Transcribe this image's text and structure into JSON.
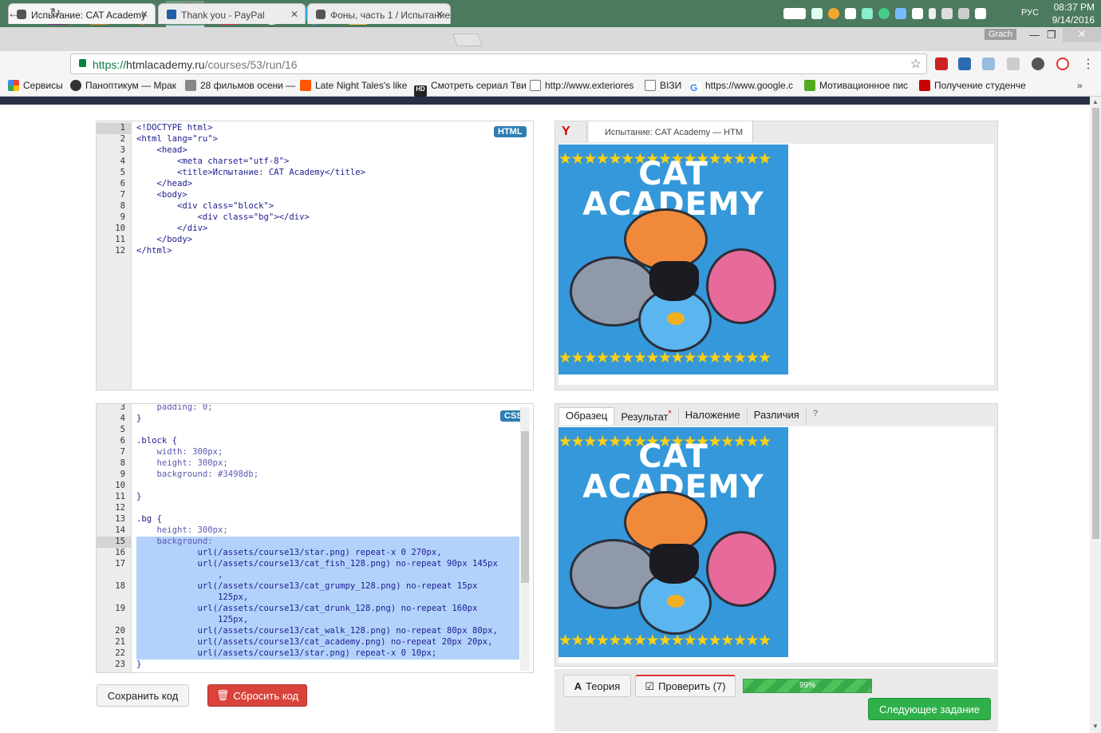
{
  "taskbar": {
    "apps": [
      {
        "name": "windows-start",
        "color": "#ffffff"
      },
      {
        "name": "onenote",
        "color": "#8b2a8c"
      },
      {
        "name": "app-orange",
        "color": "#d98c2b"
      },
      {
        "name": "firefox",
        "color": "#e6692a"
      },
      {
        "name": "chrome",
        "color": "#34a853"
      },
      {
        "name": "pocket",
        "color": "#e0344b"
      },
      {
        "name": "itunes",
        "color": "#d85ac4"
      },
      {
        "name": "telegram",
        "color": "#2ea6dd"
      },
      {
        "name": "file-explorer",
        "color": "#f3c544"
      }
    ],
    "language": "РУС",
    "time": "08:37 PM",
    "date": "9/14/2016"
  },
  "browser": {
    "tabs": [
      {
        "title": "Испытание: CAT Academy",
        "active": true
      },
      {
        "title": "Thank you - PayPal",
        "active": false
      },
      {
        "title": "Фоны, часть 1 / Испытание",
        "active": false
      }
    ],
    "profile": "Grach",
    "url_scheme": "https://",
    "url_host": "htmlacademy.ru",
    "url_path": "/courses/53/run/16",
    "bookmarks": [
      "Сервисы",
      "Паноптикум — Мрак",
      "28 фильмов осени —",
      "Late Night Tales's like",
      "Смотреть сериал Тви",
      "http://www.exteriores",
      "ВІЗИ",
      "https://www.google.c",
      "Мотивационное пис",
      "Получение студенче"
    ],
    "bookmarks_more": "»"
  },
  "html_editor": {
    "badge": "HTML",
    "lines": [
      "<!DOCTYPE html>",
      "<html lang=\"ru\">",
      "    <head>",
      "        <meta charset=\"utf-8\">",
      "        <title>Испытание: CAT Academy</title>",
      "    </head>",
      "    <body>",
      "        <div class=\"block\">",
      "            <div class=\"bg\"></div>",
      "        </div>",
      "    </body>",
      "</html>"
    ]
  },
  "css_editor": {
    "badge": "CSS",
    "lines": [
      {
        "n": "3",
        "text": "    padding: 0;"
      },
      {
        "n": "4",
        "text": "}"
      },
      {
        "n": "5",
        "text": ""
      },
      {
        "n": "6",
        "text": ".block {"
      },
      {
        "n": "7",
        "text": "    width: 300px;"
      },
      {
        "n": "8",
        "text": "    height: 300px;"
      },
      {
        "n": "9",
        "text": "    background: #3498db;"
      },
      {
        "n": "10",
        "text": ""
      },
      {
        "n": "11",
        "text": "}"
      },
      {
        "n": "12",
        "text": ""
      },
      {
        "n": "13",
        "text": ".bg {"
      },
      {
        "n": "14",
        "text": "    height: 300px;"
      },
      {
        "n": "15",
        "text": "    background:"
      },
      {
        "n": "16",
        "text": "            url(/assets/course13/star.png) repeat-x 0 270px,"
      },
      {
        "n": "17",
        "text": "            url(/assets/course13/cat_fish_128.png) no-repeat 90px 145px"
      },
      {
        "n": "",
        "text": "                ,"
      },
      {
        "n": "18",
        "text": "            url(/assets/course13/cat_grumpy_128.png) no-repeat 15px"
      },
      {
        "n": "",
        "text": "                125px,"
      },
      {
        "n": "19",
        "text": "            url(/assets/course13/cat_drunk_128.png) no-repeat 160px"
      },
      {
        "n": "",
        "text": "                125px,"
      },
      {
        "n": "20",
        "text": "            url(/assets/course13/cat_walk_128.png) no-repeat 80px 80px,"
      },
      {
        "n": "21",
        "text": "            url(/assets/course13/cat_academy.png) no-repeat 20px 20px,"
      },
      {
        "n": "22",
        "text": "            url(/assets/course13/star.png) repeat-x 0 10px;"
      },
      {
        "n": "23",
        "text": "}"
      }
    ]
  },
  "buttons": {
    "save": "Сохранить код",
    "reset": "Сбросить код",
    "theory": "Теория",
    "check": "Проверить (7)",
    "next": "Следующее задание"
  },
  "preview": {
    "tab_title": "Испытание: CAT Academy — HTM",
    "image_title_line1": "CAT",
    "image_title_line2": "ACADEMY",
    "stars": "★★★★★★★★★★★★★★★★★"
  },
  "compare": {
    "tabs": [
      "Образец",
      "Результат",
      "Наложение",
      "Различия"
    ],
    "result_marker": "*",
    "help": "?"
  },
  "progress": {
    "label": "99%",
    "value": 0.99
  }
}
